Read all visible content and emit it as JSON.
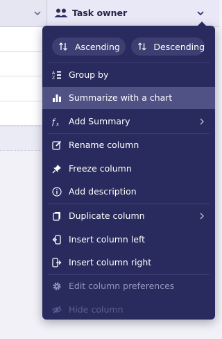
{
  "header": {
    "column_title": "Task owner",
    "icons": {
      "column_type": "people-icon",
      "dropdown": "chevron-down-icon"
    }
  },
  "menu": {
    "sort": {
      "ascending": "Ascending",
      "descending": "Descending",
      "ascending_icon": "sort-ascending-icon",
      "descending_icon": "sort-descending-icon"
    },
    "items": [
      {
        "label": "Group by",
        "icon": "group-by-icon",
        "state": "normal",
        "submenu": false
      },
      {
        "label": "Summarize with a chart",
        "icon": "bar-chart-icon",
        "state": "highlighted",
        "submenu": false
      },
      {
        "label": "Add Summary",
        "icon": "function-icon",
        "state": "normal",
        "submenu": true
      },
      {
        "label": "Rename column",
        "icon": "edit-icon",
        "state": "normal",
        "submenu": false
      },
      {
        "label": "Freeze column",
        "icon": "pin-icon",
        "state": "normal",
        "submenu": false
      },
      {
        "label": "Add description",
        "icon": "info-icon",
        "state": "normal",
        "submenu": false
      },
      {
        "label": "Duplicate column",
        "icon": "duplicate-icon",
        "state": "normal",
        "submenu": true
      },
      {
        "label": "Insert column left",
        "icon": "insert-left-icon",
        "state": "normal",
        "submenu": false
      },
      {
        "label": "Insert column right",
        "icon": "insert-right-icon",
        "state": "normal",
        "submenu": false
      },
      {
        "label": "Edit column preferences",
        "icon": "gear-icon",
        "state": "disabled",
        "submenu": false
      },
      {
        "label": "Hide column",
        "icon": "eye-off-icon",
        "state": "disabled",
        "submenu": false
      }
    ]
  },
  "colors": {
    "menu_background": "#292a5d",
    "menu_highlight": "#505286",
    "pill_background": "#3d3e72",
    "header_background": "#e8e8f7",
    "disabled_text": "#9597bd"
  }
}
